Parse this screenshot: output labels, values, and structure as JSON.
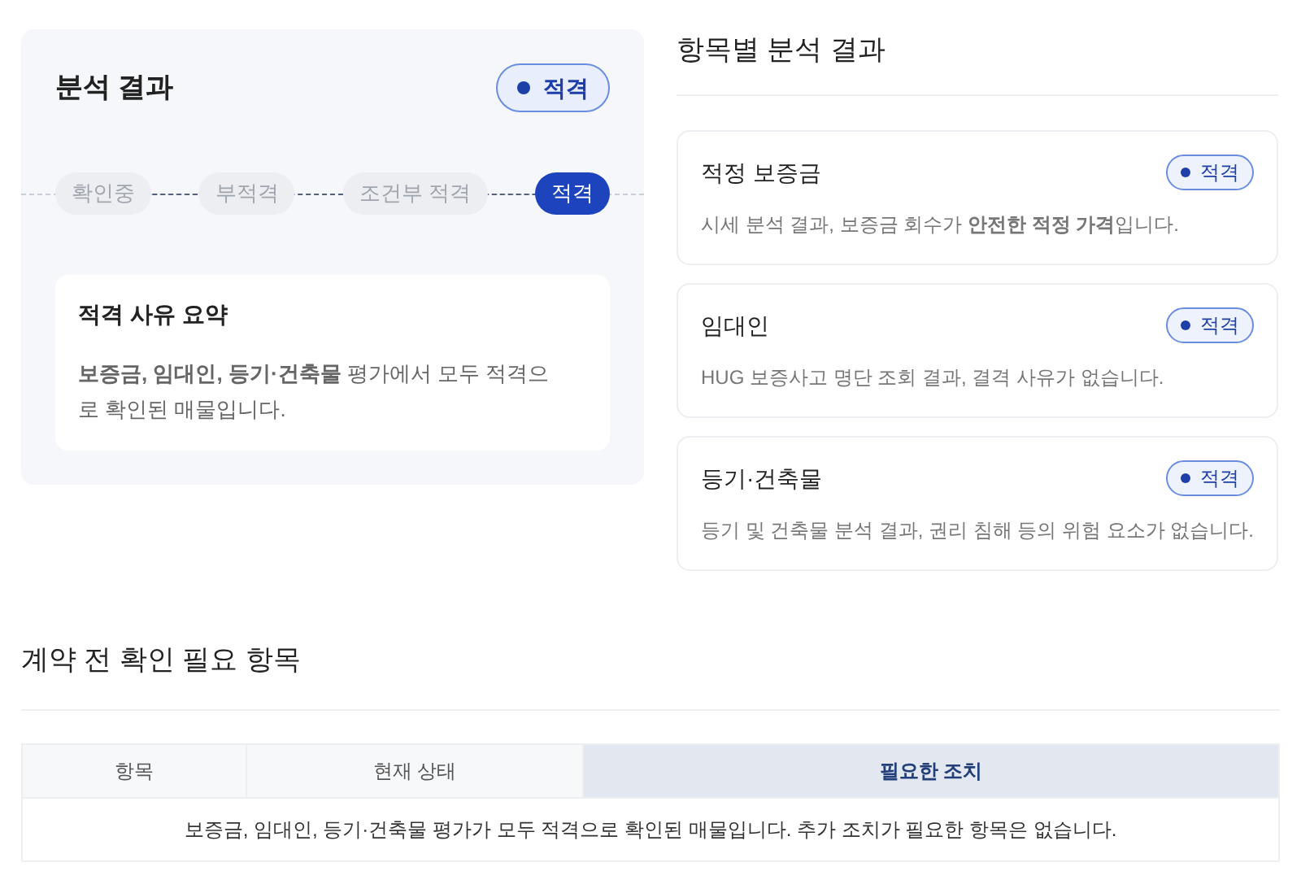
{
  "result_panel": {
    "title": "분석 결과",
    "badge": "적격",
    "steps": [
      {
        "label": "확인중",
        "selected": false
      },
      {
        "label": "부적격",
        "selected": false
      },
      {
        "label": "조건부 적격",
        "selected": false
      },
      {
        "label": "적격",
        "selected": true
      }
    ],
    "summary": {
      "title": "적격 사유 요약",
      "text": "**보증금, 임대인, 등기·건축물** 평가에서 모두 적격으로 확인된 매물입니다."
    }
  },
  "item_results": {
    "title": "항목별 분석 결과",
    "items": [
      {
        "name": "적정 보증금",
        "badge": "적격",
        "description": "시세 분석 결과, 보증금 회수가 **안전한 적정 가격**입니다."
      },
      {
        "name": "임대인",
        "badge": "적격",
        "description": "HUG 보증사고 명단 조회 결과, 결격 사유가 없습니다."
      },
      {
        "name": "등기·건축물",
        "badge": "적격",
        "description": "등기 및 건축물 분석 결과, 권리 침해 등의 위험 요소가 없습니다."
      }
    ]
  },
  "checklist": {
    "title": "계약 전 확인 필요 항목",
    "table": {
      "columns": [
        {
          "label": "항목",
          "highlighted": false
        },
        {
          "label": "현재 상태",
          "highlighted": false
        },
        {
          "label": "필요한 조치",
          "highlighted": true
        }
      ],
      "message": "보증금, 임대인, 등기·건축물 평가가 모두 적격으로 확인된 매물입니다. 추가 조치가 필요한 항목은 없습니다."
    }
  }
}
